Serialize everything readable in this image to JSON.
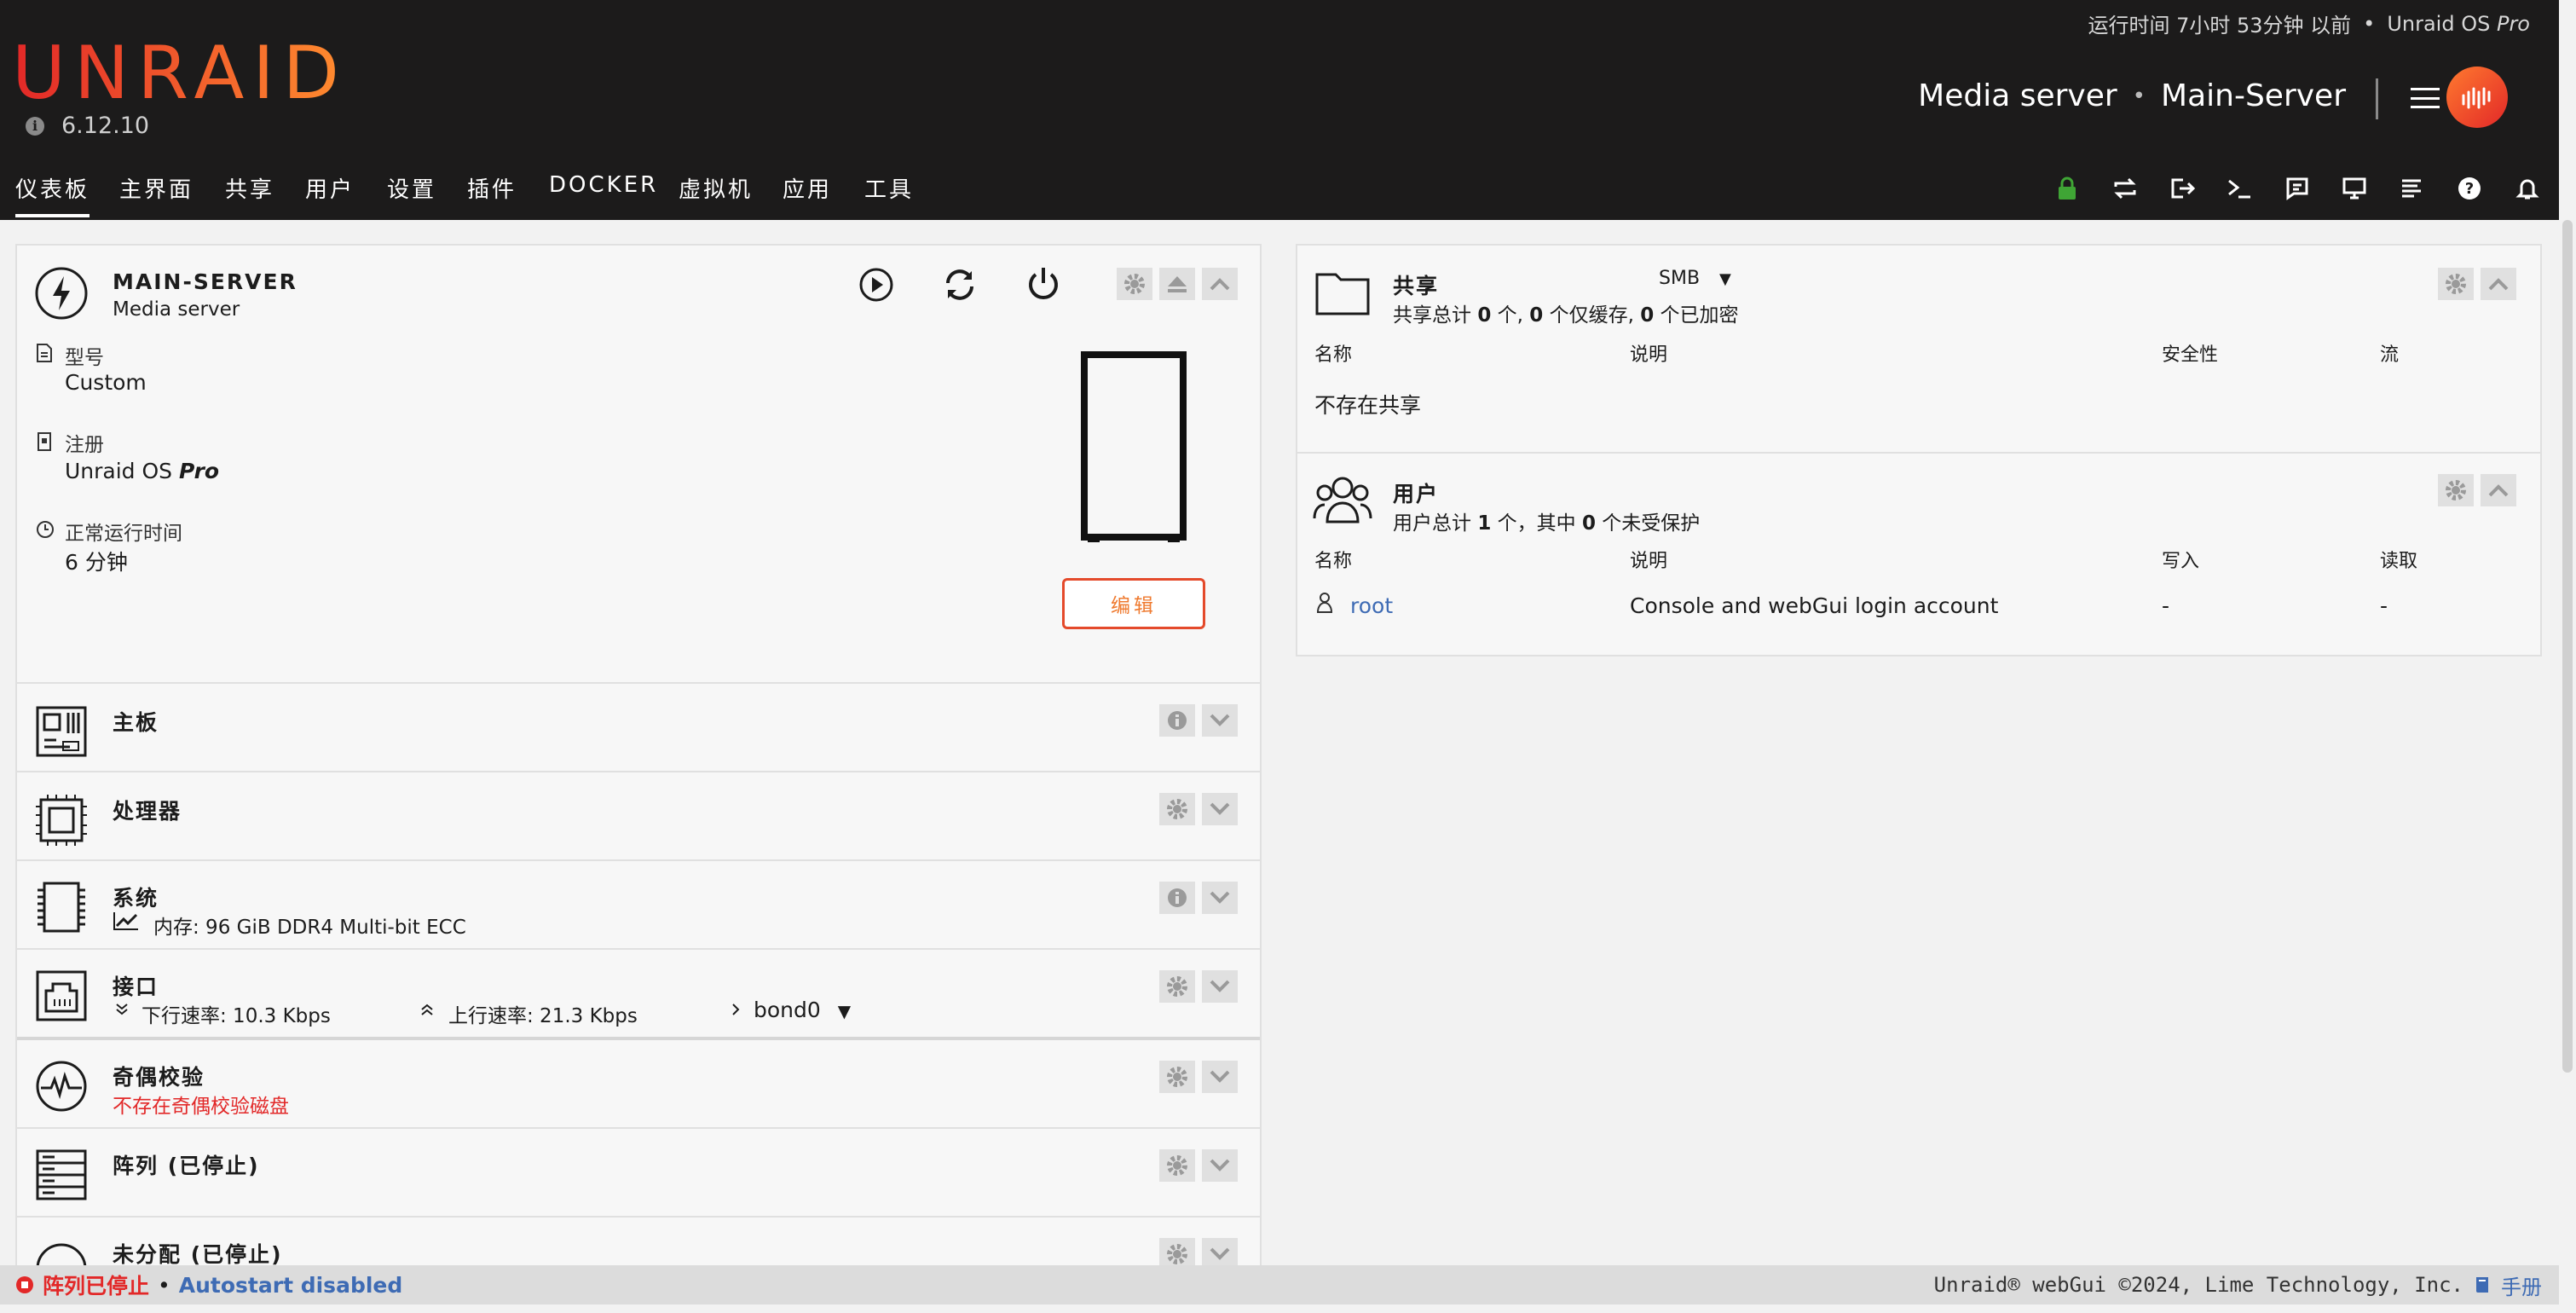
{
  "header": {
    "logo": "UNRAID",
    "version": "6.12.10",
    "uptime_text": "运行时间 7小时 53分钟 以前",
    "bullet": "•",
    "os_name": "Unraid OS",
    "os_edition": "Pro",
    "server_description": "Media server",
    "server_name": "Main-Server"
  },
  "nav": {
    "items": [
      "仪表板",
      "主界面",
      "共享",
      "用户",
      "设置",
      "插件",
      "DOCKER",
      "虚拟机",
      "应用",
      "工具"
    ],
    "active_index": 0,
    "icons": [
      "lock-icon",
      "sync-icon",
      "logout-icon",
      "terminal-icon",
      "feedback-icon",
      "monitor-icon",
      "log-icon",
      "help-icon",
      "bell-icon"
    ]
  },
  "server_card": {
    "name": "MAIN-SERVER",
    "description": "Media server",
    "model_label": "型号",
    "model_value": "Custom",
    "registration_label": "注册",
    "registration_value": "Unraid OS",
    "registration_edition": "Pro",
    "uptime_label": "正常运行时间",
    "uptime_value": "6 分钟",
    "edit_label": "编辑"
  },
  "sections": {
    "motherboard": "主板",
    "processor": "处理器",
    "system_title": "系统",
    "system_memory": "内存: 96 GiB DDR4 Multi-bit ECC",
    "interface_title": "接口",
    "download_rate": "下行速率: 10.3 Kbps",
    "upload_rate": "上行速率: 21.3 Kbps",
    "bond_name": "bond0",
    "parity_title": "奇偶校验",
    "parity_status": "不存在奇偶校验磁盘",
    "array_title": "阵列 (已停止)",
    "unassigned_title": "未分配 (已停止)"
  },
  "shares": {
    "title": "共享",
    "protocol": "SMB",
    "summary_pre": "共享总计",
    "total": "0",
    "summary_mid1": "个,",
    "cached": "0",
    "summary_mid2": "个仅缓存,",
    "encrypted": "0",
    "summary_post": "个已加密",
    "columns": [
      "名称",
      "说明",
      "安全性",
      "流"
    ],
    "empty_text": "不存在共享"
  },
  "users": {
    "title": "用户",
    "summary_pre": "用户总计",
    "total": "1",
    "summary_mid": "个，其中",
    "unprotected": "0",
    "summary_post": "个未受保护",
    "columns": [
      "名称",
      "说明",
      "写入",
      "读取"
    ],
    "rows": [
      {
        "name": "root",
        "description": "Console and webGui login account",
        "write": "-",
        "read": "-"
      }
    ]
  },
  "footer": {
    "array_status": "阵列已停止",
    "bullet": "•",
    "autostart": "Autostart disabled",
    "copyright": "Unraid® webGui ©2024, Lime Technology, Inc.",
    "manual": "手册"
  },
  "colors": {
    "accent_red": "#e22828",
    "accent_orange": "#ff8c2f",
    "link_blue": "#3e6bb4",
    "lock_green": "#3fa535",
    "header_bg": "#1c1b1b"
  }
}
